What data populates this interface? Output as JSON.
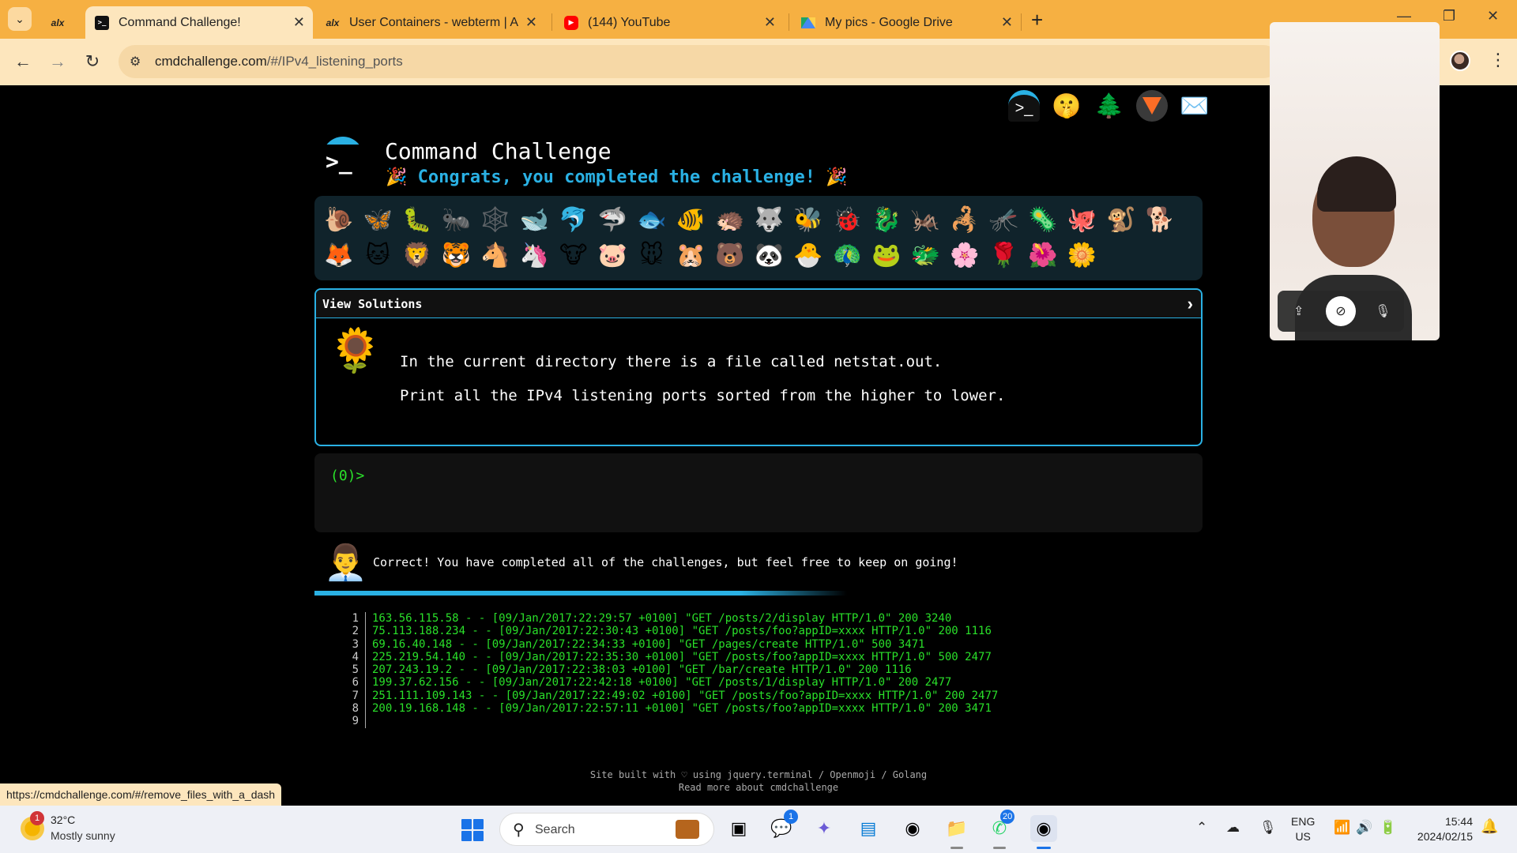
{
  "browser": {
    "tabs": [
      {
        "favicon": "alx",
        "title": ""
      },
      {
        "favicon": "terminal",
        "title": "Command Challenge!",
        "active": true
      },
      {
        "favicon": "alx",
        "title": "User Containers - webterm | AL"
      },
      {
        "favicon": "youtube",
        "title": "(144) YouTube"
      },
      {
        "favicon": "google-drive",
        "title": "My pics - Google Drive"
      }
    ],
    "new_tab": "+",
    "url_host": "cmdchallenge.com",
    "url_path": "/#/IPv4_listening_ports",
    "status_url": "https://cmdchallenge.com/#/remove_files_with_a_dash"
  },
  "page": {
    "title": "Command Challenge",
    "congrats": "🎉 Congrats, you completed the challenge! 🎉",
    "top_icons": [
      "terminal-icon",
      "shushing-face-icon",
      "tree-icon",
      "gitlab-icon",
      "mail-icon"
    ],
    "emojis": [
      "🐌",
      "🦋",
      "🐛",
      "🐜",
      "🕸️",
      "🐋",
      "🐬",
      "🦈",
      "🐟",
      "🐠",
      "🦔",
      "🐺",
      "🐝",
      "🐞",
      "🐉",
      "🦗",
      "🦂",
      "🦟",
      "🦠",
      "🐙",
      "🐒",
      "🐕",
      "🦊",
      "🐱",
      "🦁",
      "🐯",
      "🐴",
      "🦄",
      "🐮",
      "🐷",
      "🐭",
      "🐹",
      "🐻",
      "🐼",
      "🐣",
      "🦚",
      "🐸",
      "🐲",
      "🌸",
      "🌹",
      "🌺",
      "🌼"
    ],
    "challenge": {
      "header": "View Solutions",
      "chevron": "›",
      "icon": "🌻",
      "line1": "In the current directory there is a file called netstat.out.",
      "line2": "Print all the IPv4 listening ports sorted from the higher to lower."
    },
    "terminal_prompt": "(0)>",
    "result": {
      "avatar": "👨‍💼",
      "message": "Correct! You have completed all of the challenges, but feel free to keep on going!"
    },
    "progress_fraction": 0.6,
    "output_lines": [
      "163.56.115.58 - - [09/Jan/2017:22:29:57 +0100] \"GET /posts/2/display HTTP/1.0\" 200 3240",
      "75.113.188.234 - - [09/Jan/2017:22:30:43 +0100] \"GET /posts/foo?appID=xxxx HTTP/1.0\" 200 1116",
      "69.16.40.148 - - [09/Jan/2017:22:34:33 +0100] \"GET /pages/create HTTP/1.0\" 500 3471",
      "225.219.54.140 - - [09/Jan/2017:22:35:30 +0100] \"GET /posts/foo?appID=xxxx HTTP/1.0\" 500 2477",
      "207.243.19.2 - - [09/Jan/2017:22:38:03 +0100] \"GET /bar/create HTTP/1.0\" 200 1116",
      "199.37.62.156 - - [09/Jan/2017:22:42:18 +0100] \"GET /posts/1/display HTTP/1.0\" 200 2477",
      "251.111.109.143 - - [09/Jan/2017:22:49:02 +0100] \"GET /posts/foo?appID=xxxx HTTP/1.0\" 200 2477",
      "200.19.168.148 - - [09/Jan/2017:22:57:11 +0100] \"GET /posts/foo?appID=xxxx HTTP/1.0\" 200 3471",
      ""
    ],
    "footer_line1": "Site built with ♡ using jquery.terminal / Openmoji / Golang",
    "footer_line2": "Read more about cmdchallenge"
  },
  "taskbar": {
    "weather_badge": "1",
    "temperature": "32°C",
    "condition": "Mostly sunny",
    "search_placeholder": "Search",
    "teams_badge": "1",
    "whatsapp_badge": "20",
    "language_line1": "ENG",
    "language_line2": "US",
    "time": "15:44",
    "date": "2024/02/15"
  },
  "colors": {
    "accent": "#2ab1e4",
    "terminal_green": "#2ae02a",
    "chrome_tabstrip": "#f6b042",
    "chrome_toolbar": "#fde6bd"
  }
}
